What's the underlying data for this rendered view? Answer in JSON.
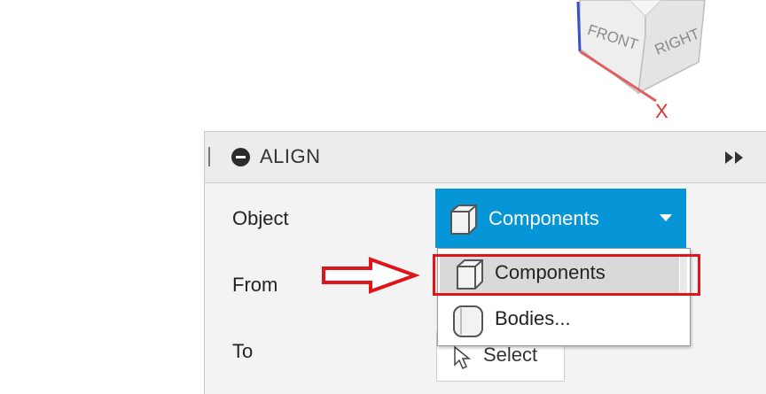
{
  "viewcube": {
    "front_label": "FRONT",
    "right_label": "RIGHT",
    "axis_label": "X"
  },
  "panel": {
    "title": "ALIGN",
    "rows": {
      "object": "Object",
      "from": "From",
      "to": "To"
    },
    "object_selector": {
      "value": "Components",
      "icon": "component-cube-icon"
    },
    "to_button": {
      "label": "Select",
      "icon": "cursor-select-icon"
    }
  },
  "dropdown": {
    "options": [
      {
        "label": "Components",
        "icon": "component-cube-icon",
        "highlighted": true
      },
      {
        "label": "Bodies...",
        "icon": "body-cylinder-icon",
        "highlighted": false
      }
    ]
  },
  "colors": {
    "accent": "#0696d7",
    "annotation": "#e0141b",
    "axis_x": "#e03030",
    "axis_z": "#3a4fd0"
  }
}
